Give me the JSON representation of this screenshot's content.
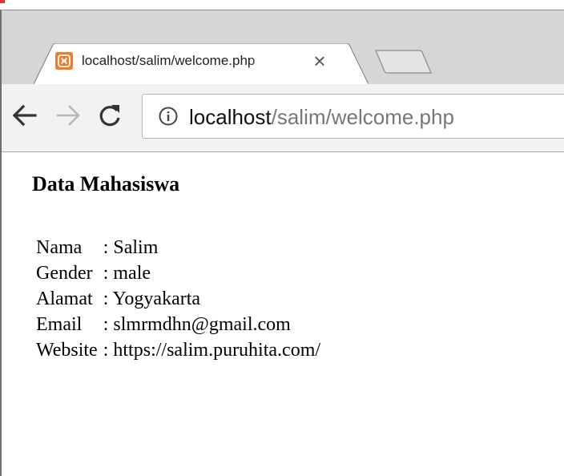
{
  "browser": {
    "tab": {
      "title": "localhost/salim/welcome.php",
      "close_glyph": "×",
      "favicon": "xampp-icon"
    },
    "address_bar": {
      "host": "localhost",
      "path": "/salim/welcome.php",
      "security_icon": "info-icon"
    },
    "nav": {
      "back_icon": "back-arrow-icon",
      "forward_icon": "forward-arrow-icon",
      "reload_icon": "reload-icon"
    }
  },
  "page": {
    "title": "Data Mahasiswa",
    "separator": ":",
    "rows": [
      {
        "label": "Nama",
        "value": "Salim"
      },
      {
        "label": "Gender",
        "value": "male"
      },
      {
        "label": "Alamat",
        "value": "Yogyakarta"
      },
      {
        "label": "Email",
        "value": "slmrmdhn@gmail.com"
      },
      {
        "label": "Website",
        "value": "https://salim.puruhita.com/"
      }
    ]
  },
  "colors": {
    "tabstrip": "#d6d6d6",
    "toolbar": "#f2f2f2",
    "favicon": "#f47a26",
    "url_path": "#777777"
  }
}
